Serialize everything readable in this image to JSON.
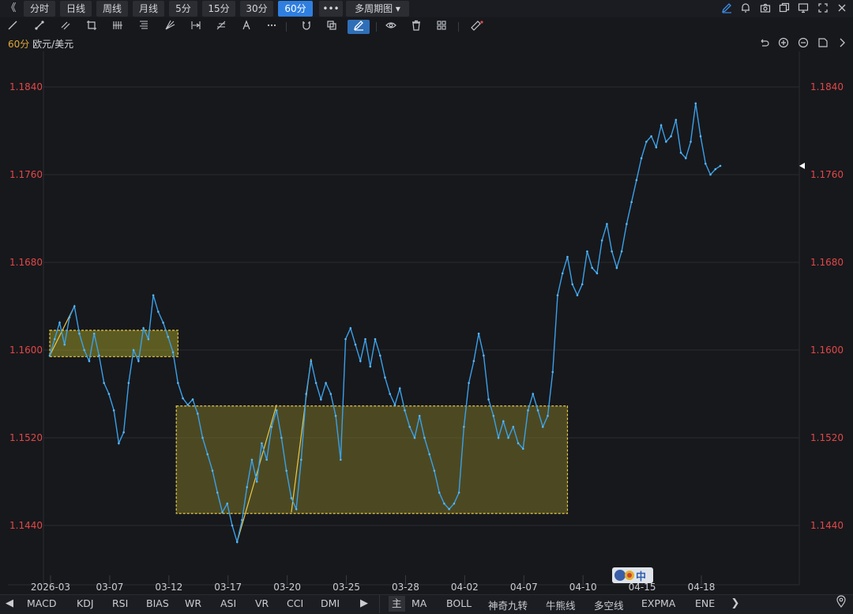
{
  "toolbar": {
    "back": "《",
    "timeframes": [
      "分时",
      "日线",
      "周线",
      "月线",
      "5分",
      "15分",
      "30分",
      "60分"
    ],
    "active_timeframe": "60分",
    "more": "•••",
    "multi_period": "多周期图",
    "multi_period_caret": "▾"
  },
  "symbol": {
    "period": "60分",
    "name": "欧元/美元"
  },
  "chart_data": {
    "type": "line",
    "x_tick_labels": [
      "2026-03",
      "03-07",
      "03-12",
      "03-17",
      "03-20",
      "03-25",
      "03-28",
      "04-02",
      "04-07",
      "04-10",
      "04-15",
      "04-18"
    ],
    "y_tick_labels": [
      "1.1840",
      "1.1760",
      "1.1680",
      "1.1600",
      "1.1520",
      "1.1440"
    ],
    "ylim": [
      1.142,
      1.189
    ],
    "last_value": 1.1768,
    "line_color": "#3aa0e8",
    "price_label_color": "#e04848",
    "grid": true,
    "series": [
      {
        "points": [
          [
            0,
            1.1595
          ],
          [
            3,
            1.161
          ],
          [
            6,
            1.1625
          ],
          [
            9,
            1.1605
          ],
          [
            12,
            1.163
          ],
          [
            15,
            1.164
          ],
          [
            18,
            1.1615
          ],
          [
            21,
            1.16
          ],
          [
            24,
            1.159
          ],
          [
            27,
            1.1615
          ],
          [
            30,
            1.1595
          ],
          [
            33,
            1.157
          ],
          [
            36,
            1.156
          ],
          [
            39,
            1.1545
          ],
          [
            42,
            1.1515
          ],
          [
            45,
            1.1525
          ],
          [
            48,
            1.157
          ],
          [
            51,
            1.16
          ],
          [
            54,
            1.159
          ],
          [
            57,
            1.162
          ],
          [
            60,
            1.161
          ],
          [
            63,
            1.165
          ],
          [
            66,
            1.1635
          ],
          [
            69,
            1.1625
          ],
          [
            72,
            1.1612
          ],
          [
            75,
            1.1598
          ],
          [
            78,
            1.157
          ],
          [
            81,
            1.1556
          ],
          [
            84,
            1.155
          ],
          [
            87,
            1.1555
          ],
          [
            90,
            1.1542
          ],
          [
            93,
            1.152
          ],
          [
            96,
            1.1505
          ],
          [
            99,
            1.149
          ],
          [
            102,
            1.147
          ],
          [
            105,
            1.1452
          ],
          [
            108,
            1.146
          ],
          [
            111,
            1.144
          ],
          [
            114,
            1.1425
          ],
          [
            117,
            1.1445
          ],
          [
            120,
            1.1475
          ],
          [
            123,
            1.15
          ],
          [
            126,
            1.148
          ],
          [
            129,
            1.1515
          ],
          [
            132,
            1.15
          ],
          [
            135,
            1.153
          ],
          [
            138,
            1.1545
          ],
          [
            141,
            1.152
          ],
          [
            144,
            1.149
          ],
          [
            147,
            1.1465
          ],
          [
            150,
            1.1455
          ],
          [
            153,
            1.15
          ],
          [
            156,
            1.156
          ],
          [
            159,
            1.159
          ],
          [
            162,
            1.157
          ],
          [
            165,
            1.1555
          ],
          [
            168,
            1.157
          ],
          [
            171,
            1.156
          ],
          [
            174,
            1.154
          ],
          [
            177,
            1.15
          ],
          [
            180,
            1.161
          ],
          [
            183,
            1.162
          ],
          [
            186,
            1.1605
          ],
          [
            189,
            1.159
          ],
          [
            192,
            1.161
          ],
          [
            195,
            1.1585
          ],
          [
            198,
            1.161
          ],
          [
            201,
            1.1595
          ],
          [
            204,
            1.1575
          ],
          [
            207,
            1.156
          ],
          [
            210,
            1.155
          ],
          [
            213,
            1.1565
          ],
          [
            216,
            1.1545
          ],
          [
            219,
            1.153
          ],
          [
            222,
            1.152
          ],
          [
            225,
            1.154
          ],
          [
            228,
            1.152
          ],
          [
            231,
            1.1505
          ],
          [
            234,
            1.149
          ],
          [
            237,
            1.147
          ],
          [
            240,
            1.146
          ],
          [
            243,
            1.1455
          ],
          [
            246,
            1.146
          ],
          [
            249,
            1.147
          ],
          [
            252,
            1.153
          ],
          [
            255,
            1.157
          ],
          [
            258,
            1.159
          ],
          [
            261,
            1.1615
          ],
          [
            264,
            1.1595
          ],
          [
            267,
            1.1555
          ],
          [
            270,
            1.154
          ],
          [
            273,
            1.152
          ],
          [
            276,
            1.1535
          ],
          [
            279,
            1.152
          ],
          [
            282,
            1.153
          ],
          [
            285,
            1.1515
          ],
          [
            288,
            1.151
          ],
          [
            291,
            1.1545
          ],
          [
            294,
            1.156
          ],
          [
            297,
            1.1545
          ],
          [
            300,
            1.153
          ],
          [
            303,
            1.154
          ],
          [
            306,
            1.158
          ],
          [
            309,
            1.165
          ],
          [
            312,
            1.167
          ],
          [
            315,
            1.1685
          ],
          [
            318,
            1.166
          ],
          [
            321,
            1.165
          ],
          [
            324,
            1.166
          ],
          [
            327,
            1.169
          ],
          [
            330,
            1.1675
          ],
          [
            333,
            1.167
          ],
          [
            336,
            1.17
          ],
          [
            339,
            1.1715
          ],
          [
            342,
            1.169
          ],
          [
            345,
            1.1675
          ],
          [
            348,
            1.169
          ],
          [
            351,
            1.1715
          ],
          [
            354,
            1.1735
          ],
          [
            357,
            1.1755
          ],
          [
            360,
            1.1775
          ],
          [
            363,
            1.179
          ],
          [
            366,
            1.1795
          ],
          [
            369,
            1.1785
          ],
          [
            372,
            1.1805
          ],
          [
            375,
            1.179
          ],
          [
            378,
            1.1795
          ],
          [
            381,
            1.181
          ],
          [
            384,
            1.178
          ],
          [
            387,
            1.1775
          ],
          [
            390,
            1.179
          ],
          [
            393,
            1.1825
          ],
          [
            396,
            1.1795
          ],
          [
            399,
            1.177
          ],
          [
            402,
            1.176
          ],
          [
            405,
            1.1765
          ],
          [
            408,
            1.1768
          ]
        ]
      }
    ],
    "annotations": [
      {
        "type": "rect",
        "x1": 0,
        "x2": 78,
        "y1": 1.1594,
        "y2": 1.1618,
        "fill": "rgba(150,150,40,0.55)",
        "stroke": "#e8c84a"
      },
      {
        "type": "rect",
        "x1": 77,
        "x2": 315,
        "y1": 1.1451,
        "y2": 1.1549,
        "fill": "rgba(120,115,40,0.55)",
        "stroke": "#e8c84a"
      },
      {
        "type": "segment",
        "x1": 0,
        "y1": 1.1595,
        "x2": 15,
        "y2": 1.164,
        "stroke": "#e8c84a"
      },
      {
        "type": "segment",
        "x1": 114,
        "y1": 1.1425,
        "x2": 138,
        "y2": 1.155,
        "stroke": "#e8c84a"
      },
      {
        "type": "segment",
        "x1": 147,
        "y1": 1.1452,
        "x2": 159,
        "y2": 1.1592,
        "stroke": "#e8c84a"
      }
    ]
  },
  "badge": {
    "text": "中"
  },
  "bottom": {
    "prev": "◀",
    "indicators": [
      "MACD",
      "KDJ",
      "RSI",
      "BIAS",
      "WR",
      "ASI",
      "VR",
      "CCI",
      "DMI"
    ],
    "next": "▶",
    "main_label": "主",
    "overlays": [
      "MA",
      "BOLL",
      "神奇九转",
      "牛熊线",
      "多空线",
      "EXPMA",
      "ENE"
    ],
    "more": "❯"
  }
}
